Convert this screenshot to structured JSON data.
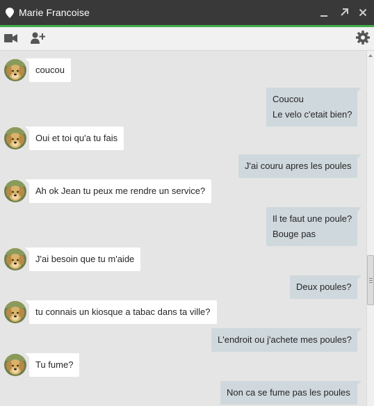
{
  "window": {
    "title": "Marie Francoise"
  },
  "toolbar": {
    "icons": [
      "video-camera-icon",
      "add-person-icon",
      "gear-icon"
    ]
  },
  "colors": {
    "titlebar": "#393939",
    "accent_line": "#3fae49",
    "incoming_bubble": "#ffffff",
    "outgoing_bubble": "#cfd8dc",
    "background": "#e5e5e5"
  },
  "messages": [
    {
      "from": "contact",
      "lines": [
        "coucou"
      ]
    },
    {
      "from": "me",
      "lines": [
        "Coucou",
        "Le velo c'etait bien?"
      ]
    },
    {
      "from": "contact",
      "lines": [
        "Oui et toi qu'a tu fais"
      ]
    },
    {
      "from": "me",
      "lines": [
        "J'ai couru apres les poules"
      ]
    },
    {
      "from": "contact",
      "lines": [
        "Ah ok Jean tu peux me rendre un service?"
      ]
    },
    {
      "from": "me",
      "lines": [
        "Il te faut une poule?",
        "Bouge pas"
      ]
    },
    {
      "from": "contact",
      "lines": [
        "J'ai besoin que tu m'aide"
      ]
    },
    {
      "from": "me",
      "lines": [
        "Deux poules?"
      ]
    },
    {
      "from": "contact",
      "lines": [
        "tu connais un kiosque a tabac dans ta ville?"
      ]
    },
    {
      "from": "me",
      "lines": [
        "L'endroit ou j'achete mes poules?"
      ]
    },
    {
      "from": "contact",
      "lines": [
        "Tu fume?"
      ]
    },
    {
      "from": "me",
      "lines": [
        "Non ca se fume pas les poules"
      ]
    }
  ]
}
